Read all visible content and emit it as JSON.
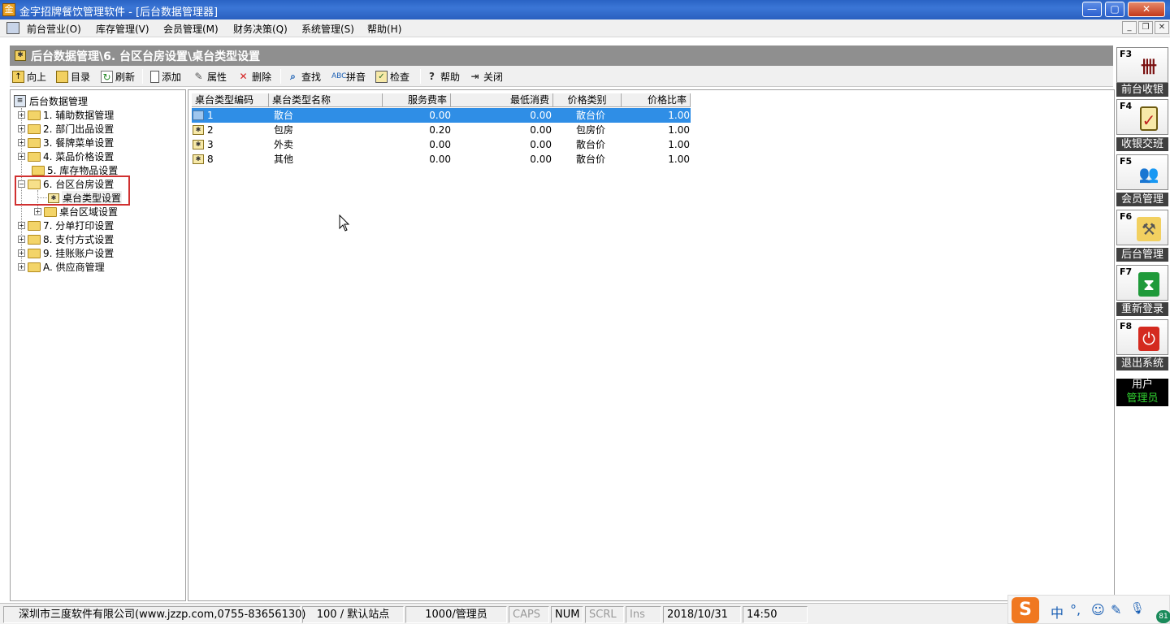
{
  "window": {
    "title": "金字招牌餐饮管理软件 - [后台数据管理器]",
    "min_glyph": "—",
    "max_glyph": "▢",
    "close_glyph": "✕"
  },
  "menu": {
    "items": [
      "前台营业(O)",
      "库存管理(V)",
      "会员管理(M)",
      "财务决策(Q)",
      "系统管理(S)",
      "帮助(H)"
    ],
    "mdi_min": "_",
    "mdi_restore": "❐",
    "mdi_close": "✕"
  },
  "header": {
    "breadcrumb": "后台数据管理\\6. 台区台房设置\\桌台类型设置"
  },
  "toolbar": {
    "up": "向上",
    "directory": "目录",
    "refresh": "刷新",
    "add": "添加",
    "properties": "属性",
    "delete": "删除",
    "find": "查找",
    "pinyin": "拼音",
    "check": "检查",
    "help": "帮助",
    "close": "关闭"
  },
  "tree": {
    "root": "后台数据管理",
    "nodes": [
      "1. 辅助数据管理",
      "2. 部门出品设置",
      "3. 餐牌菜单设置",
      "4. 菜品价格设置",
      "5. 库存物品设置",
      "6. 台区台房设置",
      "桌台类型设置",
      "桌台区域设置",
      "7. 分单打印设置",
      "8. 支付方式设置",
      "9. 挂账账户设置",
      "A. 供应商管理"
    ],
    "selected": "桌台类型设置"
  },
  "grid": {
    "columns": [
      "桌台类型编码",
      "桌台类型名称",
      "服务费率",
      "最低消费",
      "价格类别",
      "价格比率"
    ],
    "rows": [
      {
        "code": "1",
        "name": "散台",
        "service_rate": "0.00",
        "min_spend": "0.00",
        "price_type": "散台价",
        "ratio": "1.00",
        "selected": true
      },
      {
        "code": "2",
        "name": "包房",
        "service_rate": "0.20",
        "min_spend": "0.00",
        "price_type": "包房价",
        "ratio": "1.00",
        "selected": false
      },
      {
        "code": "3",
        "name": "外卖",
        "service_rate": "0.00",
        "min_spend": "0.00",
        "price_type": "散台价",
        "ratio": "1.00",
        "selected": false
      },
      {
        "code": "8",
        "name": "其他",
        "service_rate": "0.00",
        "min_spend": "0.00",
        "price_type": "散台价",
        "ratio": "1.00",
        "selected": false
      }
    ]
  },
  "fkeys": [
    {
      "code": "F3",
      "label": "前台收银",
      "icon": "cashier-icon",
      "color": "#7a1010"
    },
    {
      "code": "F4",
      "label": "收银交班",
      "icon": "clipboard-check-icon",
      "color": "#c02020"
    },
    {
      "code": "F5",
      "label": "会员管理",
      "icon": "members-icon",
      "color": "#2a6fc4"
    },
    {
      "code": "F6",
      "label": "后台管理",
      "icon": "tools-folder-icon",
      "color": "#c8901c"
    },
    {
      "code": "F7",
      "label": "重新登录",
      "icon": "hourglass-icon",
      "color": "#1f9a3a"
    },
    {
      "code": "F8",
      "label": "退出系统",
      "icon": "power-icon",
      "color": "#d42a1f"
    }
  ],
  "user": {
    "title": "用户",
    "name": "管理员"
  },
  "statusbar": {
    "company": "深圳市三度软件有限公司(www.jzzp.com,0755-83656130)",
    "station": "100 / 默认站点",
    "operator": "1000/管理员",
    "caps": "CAPS",
    "num": "NUM",
    "scrl": "SCRL",
    "ins": "Ins",
    "date": "2018/10/31",
    "time": "14:50"
  },
  "ime": {
    "logo": "S",
    "mode": "中",
    "punct": "°,",
    "emoji": "☺",
    "pen": "✎",
    "mic": "🎙",
    "badge": "81"
  }
}
